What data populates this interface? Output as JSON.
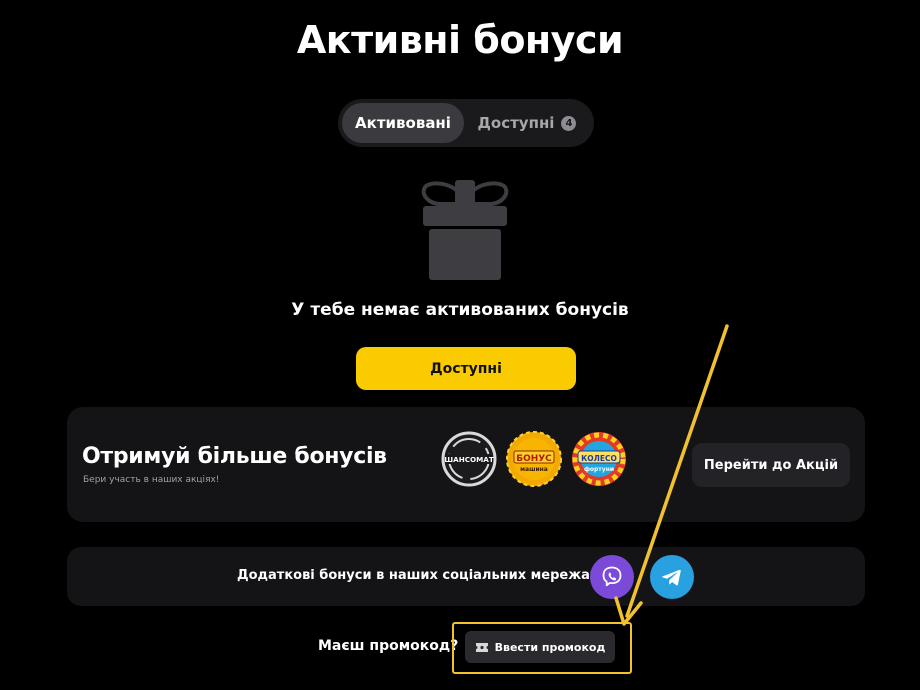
{
  "page": {
    "title": "Активні бонуси"
  },
  "tabs": [
    {
      "label": "Активовані",
      "active": true
    },
    {
      "label": "Доступні",
      "badge": "4",
      "active": false
    }
  ],
  "empty_state": {
    "icon": "gift-icon",
    "message": "У тебе немає активованих бонусів",
    "button_label": "Доступні"
  },
  "promo_card": {
    "title": "Отримуй більше бонусів",
    "subtitle": "Бери участь в наших акціях!",
    "logos": [
      {
        "name": "shansomat-logo",
        "text": "ШАНСОМАТ"
      },
      {
        "name": "bonus-machine-logo",
        "line1": "БОНУС",
        "line2": "машина"
      },
      {
        "name": "wheel-of-fortune-logo",
        "line1": "КОЛЕСО",
        "line2": "фортуни"
      }
    ],
    "button_label": "Перейти до Акцій"
  },
  "social": {
    "text": "Додаткові бонуси в наших соціальних мережах",
    "networks": [
      {
        "name": "viber",
        "icon": "viber-icon",
        "color": "#7b4ad9"
      },
      {
        "name": "telegram",
        "icon": "telegram-icon",
        "color": "#29a1e0"
      }
    ]
  },
  "promo_code": {
    "question": "Маєш промокод?",
    "button_label": "Ввести промокод",
    "icon": "ticket-icon"
  },
  "colors": {
    "background": "#000000",
    "card": "#141416",
    "accent": "#f9cb00",
    "highlight": "#f2c12e"
  }
}
